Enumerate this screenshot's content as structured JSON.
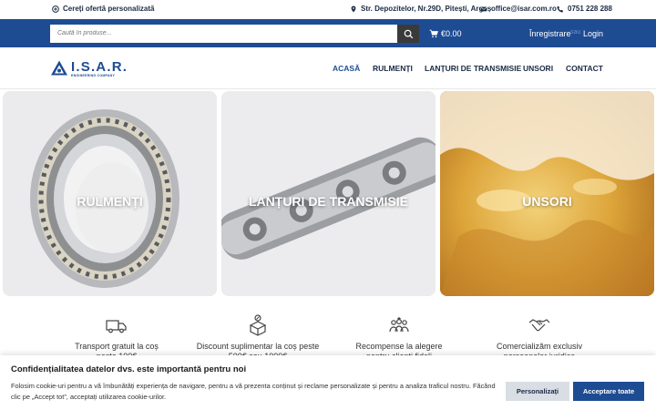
{
  "topbar": {
    "offer": "Cereți ofertă personalizată",
    "address": "Str. Depozitelor, Nr.29D, Pitești, Argeș",
    "email": "office@isar.com.ro",
    "phone": "0751 228 288"
  },
  "searchbar": {
    "placeholder": "Caută în produse...",
    "cart_total": "€0.00",
    "register": "Înregistrare",
    "separator": "sau",
    "login": "Login"
  },
  "logo": {
    "name": "I.S.A.R.",
    "tagline": "ENGINEERING COMPANY"
  },
  "nav": {
    "items": [
      "ACASĂ",
      "RULMENȚI",
      "LANȚURI DE TRANSMISIE",
      "UNSORI",
      "CONTACT"
    ],
    "active": "ACASĂ"
  },
  "categories": [
    "RULMENȚI",
    "LANȚURI DE TRANSMISIE",
    "UNSORI"
  ],
  "features": [
    {
      "icon": "delivery-truck-icon",
      "lines": [
        "Transport gratuit la coș",
        "peste 100€"
      ]
    },
    {
      "icon": "discount-box-icon",
      "lines": [
        "Discount suplimentar la coș peste",
        "500€ sau 1000€"
      ]
    },
    {
      "icon": "loyalty-people-icon",
      "lines": [
        "Recompense la alegere",
        "pentru clienți fideli"
      ]
    },
    {
      "icon": "handshake-icon",
      "lines": [
        "Comercializăm exclusiv",
        "persoanelor juridice"
      ]
    }
  ],
  "cookie": {
    "title": "Confidențialitatea datelor dvs. este importantă pentru noi",
    "text": "Folosim cookie-uri pentru a vă îmbunătăți experiența de navigare, pentru a vă prezenta conținut și reclame personalizate și pentru a analiza traficul nostru. Făcând clic pe „Accept tot”, acceptați utilizarea cookie-urilor.",
    "customize": "Personalizați",
    "accept_all": "Acceptare toate"
  },
  "colors": {
    "brand_blue": "#1e4c93",
    "dark_text": "#1a2a44",
    "search_button": "#3a3a3a"
  }
}
